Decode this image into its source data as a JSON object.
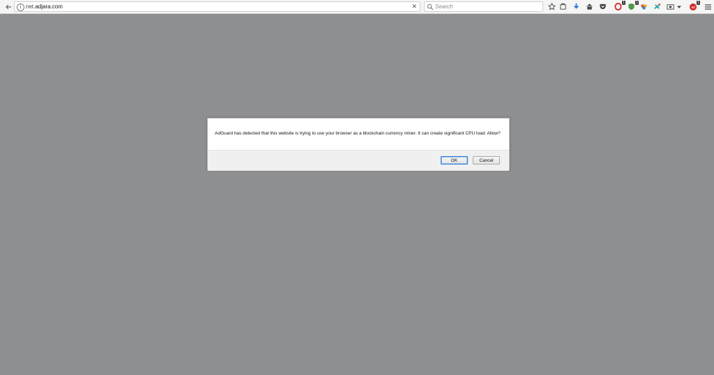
{
  "browser": {
    "url_host_prefix": "net.",
    "url_domain": "adjara.com",
    "search_placeholder": "Search",
    "toolbar_badges": {
      "opera_ext": "1",
      "shield_ext": "1",
      "adguard_ext": "1"
    }
  },
  "dialog": {
    "message": "AdGuard has detected that this website is trying to use your browser as a blockchain currency miner. It can create significant CPU load. Allow?",
    "ok_label": "OK",
    "cancel_label": "Cancel"
  },
  "colors": {
    "page_overlay": "#8e8f90",
    "ok_focus": "#2f7bd5",
    "download_arrow": "#2a7ad8"
  }
}
